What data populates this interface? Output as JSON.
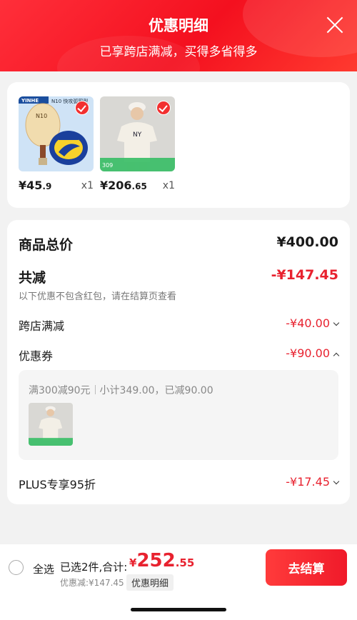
{
  "header": {
    "title": "优惠明细",
    "subtitle": "已享跨店满减，买得多省得多"
  },
  "products": [
    {
      "name": "N10 快攻弧圈型",
      "brand": "YINHE",
      "price_int": "¥45",
      "price_frac": ".9",
      "qty": "x1"
    },
    {
      "price_int": "¥206",
      "price_frac": ".65",
      "qty": "x1",
      "tag_price": "309"
    }
  ],
  "summary": {
    "total_label": "商品总价",
    "total_value": "¥400.00",
    "discount_label": "共减",
    "discount_value": "-¥147.45",
    "discount_note": "以下优惠不包含红包，请在结算页查看",
    "cross_store_label": "跨店满减",
    "cross_store_value": "-¥40.00",
    "coupon_label": "优惠券",
    "coupon_value": "-¥90.00",
    "coupon_rule": "满300减90元",
    "coupon_detail": "小计349.00，已减90.00",
    "plus_label": "PLUS专享95折",
    "plus_value": "-¥17.45"
  },
  "bottom": {
    "select_all": "全选",
    "selected": "已选2件,合计:",
    "currency": "¥",
    "total_int": "252",
    "total_frac": ".55",
    "saved": "优惠减:¥147.45",
    "detail_link": "优惠明细",
    "checkout": "去结算"
  },
  "colors": {
    "accent": "#e8222f",
    "header": "#f4101f"
  }
}
